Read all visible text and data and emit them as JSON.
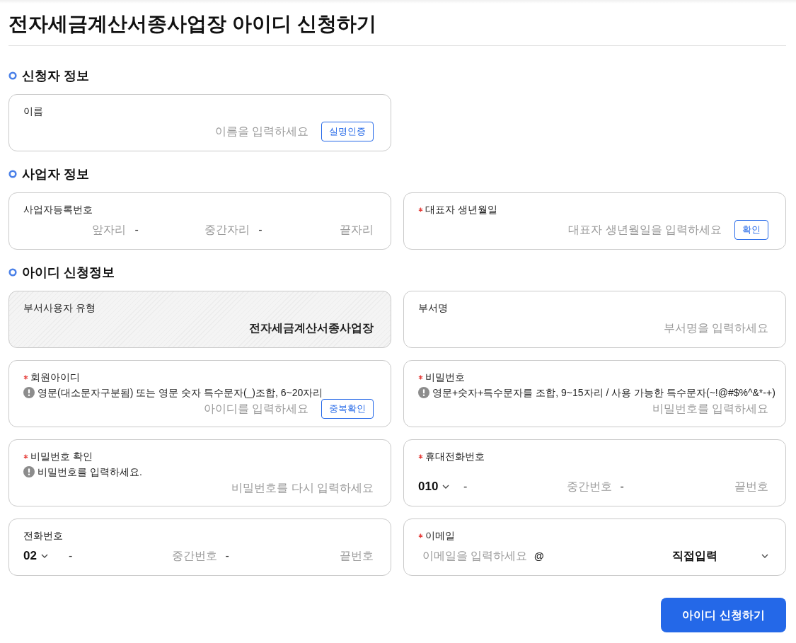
{
  "title": "전자세금계산서종사업장 아이디 신청하기",
  "sections": [
    {
      "heading": "신청자 정보",
      "fields": [
        {
          "kind": "text",
          "label": "이름",
          "required": false,
          "placeholder": "이름을 입력하세요",
          "button": "실명인증"
        }
      ]
    },
    {
      "heading": "사업자 정보",
      "fields": [
        {
          "kind": "split",
          "label": "사업자등록번호",
          "required": false,
          "separator": "-",
          "placeholders": [
            "앞자리",
            "중간자리",
            "끝자리"
          ]
        },
        {
          "kind": "text",
          "label": "대표자 생년월일",
          "required": true,
          "placeholder": "대표자 생년월일을 입력하세요",
          "button": "확인"
        }
      ]
    },
    {
      "heading": "아이디 신청정보",
      "fields": [
        {
          "kind": "readonly",
          "label": "부서사용자 유형",
          "required": false,
          "value": "전자세금계산서종사업장"
        },
        {
          "kind": "text",
          "label": "부서명",
          "required": false,
          "placeholder": "부서명을 입력하세요"
        },
        {
          "kind": "text",
          "label": "회원아이디",
          "required": true,
          "hint": "영문(대소문자구분됨) 또는 영문 숫자 특수문자(_)조합, 6~20자리",
          "placeholder": "아이디를 입력하세요",
          "button": "중복확인"
        },
        {
          "kind": "text",
          "label": "비밀번호",
          "required": true,
          "hint": "영문+숫자+특수문자를 조합, 9~15자리 / 사용 가능한 특수문자(~!@#$%^&*-+)",
          "placeholder": "비밀번호를 입력하세요"
        },
        {
          "kind": "text",
          "label": "비밀번호 확인",
          "required": true,
          "hint": "비밀번호를 입력하세요.",
          "placeholder": "비밀번호를 다시 입력하세요"
        },
        {
          "kind": "phone",
          "label": "휴대전화번호",
          "required": true,
          "prefix": "010",
          "separator": "-",
          "placeholders": [
            "중간번호",
            "끝번호"
          ]
        },
        {
          "kind": "phone",
          "label": "전화번호",
          "required": false,
          "prefix": "02",
          "separator": "-",
          "placeholders": [
            "중간번호",
            "끝번호"
          ]
        },
        {
          "kind": "email",
          "label": "이메일",
          "required": true,
          "placeholder": "이메일을 입력하세요",
          "at": "@",
          "domain": "직접입력"
        }
      ]
    }
  ],
  "submit": "아이디 신청하기"
}
